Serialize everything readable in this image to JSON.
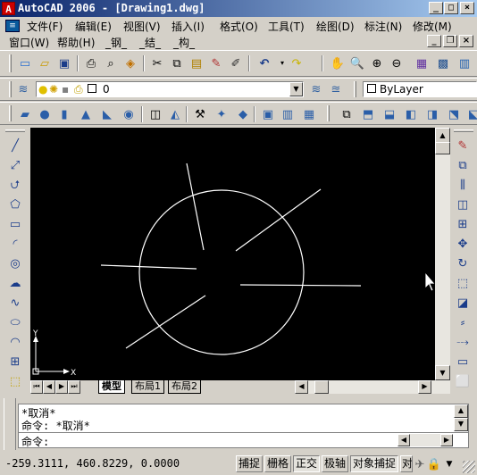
{
  "title": "AutoCAD 2006 - [Drawing1.dwg]",
  "menus_row1": [
    "文件(F)",
    "编辑(E)",
    "视图(V)",
    "插入(I)",
    "格式(O)",
    "工具(T)",
    "绘图(D)",
    "标注(N)",
    "修改(M)"
  ],
  "menus_row2": [
    "窗口(W)",
    "帮助(H)",
    "_钢_",
    "_结_",
    "_构_"
  ],
  "layer": {
    "value": "0"
  },
  "color": {
    "value": "ByLayer"
  },
  "tabs": [
    "模型",
    "布局1",
    "布局2"
  ],
  "command": {
    "lines": [
      "*取消*",
      "命令: *取消*",
      "命令:"
    ]
  },
  "status": {
    "coords": "-259.3111, 460.8229, 0.0000",
    "buttons": [
      "捕捉",
      "栅格",
      "正交",
      "极轴",
      "对象捕捉",
      "对"
    ]
  },
  "icons": {
    "ucs": "ucs-icon",
    "cursor": "cursor-arrow-icon"
  }
}
